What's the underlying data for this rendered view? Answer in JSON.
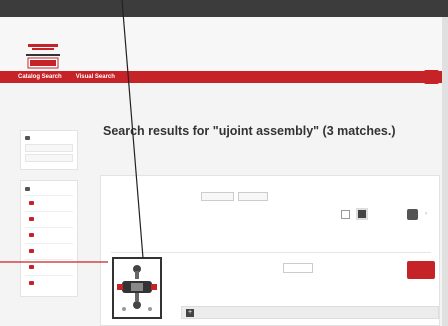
{
  "topbar": {
    "region_label": "",
    "language_label": "",
    "account_links": ""
  },
  "header": {
    "logo_text": "",
    "search_scope": "",
    "search_value": "",
    "search_placeholder": ""
  },
  "nav": {
    "items": [
      {
        "label": "Catalog Search"
      },
      {
        "label": "Visual Search"
      }
    ]
  },
  "breadcrumb": {
    "items": [
      "",
      "",
      ""
    ]
  },
  "sidebar": {
    "category_title": "",
    "categories": [
      "",
      ""
    ],
    "filter_title": "",
    "filters": [
      "",
      "",
      "",
      "",
      "",
      "",
      ""
    ]
  },
  "results": {
    "title": "Search results for \"ujoint assembly\" (3 matches.)",
    "didyoumean_prefix": "",
    "suggestions": [
      "",
      "",
      "",
      "",
      "",
      ""
    ],
    "search_note": ""
  },
  "panel": {
    "count_text": "",
    "sort_value": "",
    "per_page_value": "",
    "columns": {
      "product": "",
      "qty": "",
      "availability": "",
      "price": ""
    },
    "product": {
      "part_number": "",
      "description_label": "",
      "description": "",
      "qty_value": "",
      "add_to_cart_label": "",
      "attributes_label": ""
    }
  },
  "colors": {
    "accent": "#c62328",
    "dark": "#3c3c3c"
  }
}
